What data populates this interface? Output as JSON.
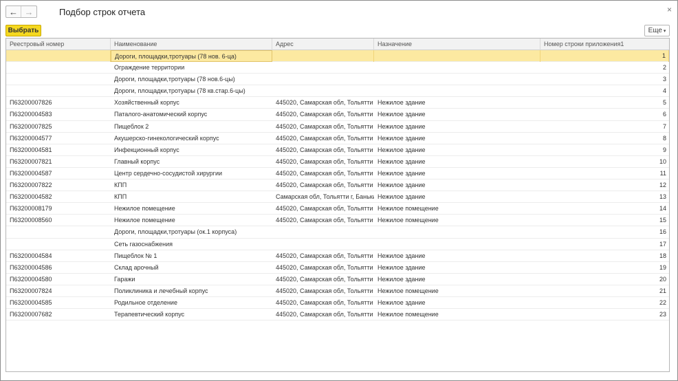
{
  "window": {
    "title": "Подбор строк отчета"
  },
  "nav": {
    "back_glyph": "←",
    "forward_glyph": "→"
  },
  "toolbar": {
    "select_label": "Выбрать",
    "more_label": "Еще",
    "more_caret": "▾",
    "close_glyph": "×"
  },
  "columns": [
    "Реестровый номер",
    "Наименование",
    "Адрес",
    "Назначение",
    "Номер строки приложения1"
  ],
  "rows": [
    [
      "",
      "Дороги, площадки,тротуары (78 нов. 6-ца)",
      "",
      "",
      "1"
    ],
    [
      "",
      "Ограждение территории",
      "",
      "",
      "2"
    ],
    [
      "",
      "Дороги, площадки,тротуары (78 нов.6-цы)",
      "",
      "",
      "3"
    ],
    [
      "",
      "Дороги, площадки,тротуары (78 кв.стар.6-цы)",
      "",
      "",
      "4"
    ],
    [
      "П63200007826",
      "Хозяйственный корпус",
      "445020, Самарская обл, Тольятти г, Б...",
      "Нежилое здание",
      "5"
    ],
    [
      "П63200004583",
      "Паталого-анатомический корпус",
      "445020, Самарская обл, Тольятти г, Б...",
      "Нежилое здание",
      "6"
    ],
    [
      "П63200007825",
      "Пищеблок 2",
      "445020, Самарская обл, Тольятти г, Б...",
      "Нежилое здание",
      "7"
    ],
    [
      "П63200004577",
      "Акушерско-гинекологический корпус",
      "445020, Самарская обл, Тольятти г, Б...",
      "Нежилое здание",
      "8"
    ],
    [
      "П63200004581",
      "Инфекционный корпус",
      "445020, Самарская обл, Тольятти г, Б...",
      "Нежилое здание",
      "9"
    ],
    [
      "П63200007821",
      "Главный корпус",
      "445020, Самарская обл, Тольятти г, Б...",
      "Нежилое здание",
      "10"
    ],
    [
      "П63200004587",
      "Центр сердечно-сосудистой хирургии",
      "445020, Самарская обл, Тольятти г, Б...",
      "Нежилое здание",
      "11"
    ],
    [
      "П63200007822",
      "КПП",
      "445020, Самарская обл, Тольятти г, Б...",
      "Нежилое здание",
      "12"
    ],
    [
      "П63200004582",
      "КПП",
      "Самарская обл, Тольятти г, Банькина...",
      "Нежилое здание",
      "13"
    ],
    [
      "П63200008179",
      "Нежилое помещение",
      "445020, Самарская обл, Тольятти г, Б...",
      "Нежилое помещение",
      "14"
    ],
    [
      "П63200008560",
      "Нежилое помещение",
      "445020, Самарская обл, Тольятти г, Б...",
      "Нежилое помещение",
      "15"
    ],
    [
      "",
      "Дороги, площадки,тротуары (ок.1 корпуса)",
      "",
      "",
      "16"
    ],
    [
      "",
      "Сеть газоснабжения",
      "",
      "",
      "17"
    ],
    [
      "П63200004584",
      "Пищеблок № 1",
      "445020, Самарская обл, Тольятти г, Б...",
      "Нежилое здание",
      "18"
    ],
    [
      "П63200004586",
      "Склад арочный",
      "445020, Самарская обл, Тольятти г, Б...",
      "Нежилое здание",
      "19"
    ],
    [
      "П63200004580",
      "Гаражи",
      "445020, Самарская обл, Тольятти г, Б...",
      "Нежилое здание",
      "20"
    ],
    [
      "П63200007824",
      "Поликлиника и лечебный корпус",
      "445020, Самарская обл, Тольятти г, Б...",
      "Нежилое помещение",
      "21"
    ],
    [
      "П63200004585",
      "Родильное отделение",
      "445020, Самарская обл, Тольятти г, Б...",
      "Нежилое здание",
      "22"
    ],
    [
      "П63200007682",
      "Терапевтический корпус",
      "445020, Самарская обл, Тольятти г, Б...",
      "Нежилое помещение",
      "23"
    ]
  ],
  "selected_row": 0,
  "colors": {
    "accent_button": "#f5d820",
    "selected_row": "#fce9a1"
  }
}
